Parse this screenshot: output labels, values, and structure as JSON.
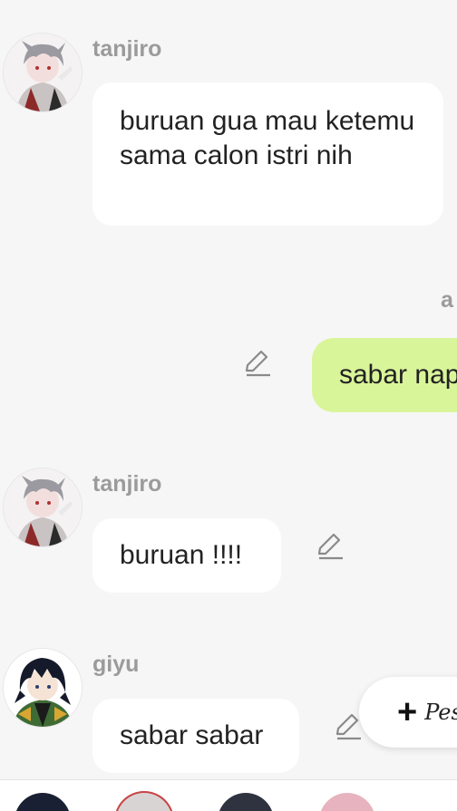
{
  "messages": [
    {
      "sender": "tanjiro",
      "text": "buruan gua mau ketemu sama calon istri nih"
    },
    {
      "self_name": "a",
      "text": "sabar nap"
    },
    {
      "sender": "tanjiro",
      "text": "buruan !!!!"
    },
    {
      "sender": "giyu",
      "text": "sabar sabar"
    }
  ],
  "fab": {
    "plus": "+",
    "label": "Pes"
  },
  "icons": {
    "avatar_tanjiro": "tanjiro-avatar",
    "avatar_giyu": "giyu-avatar",
    "edit": "pencil-icon",
    "add": "plus-icon"
  },
  "colors": {
    "background": "#f6f6f6",
    "bubble_other": "#ffffff",
    "bubble_self": "#d9f59a",
    "sender_name": "#9b9b9b"
  }
}
